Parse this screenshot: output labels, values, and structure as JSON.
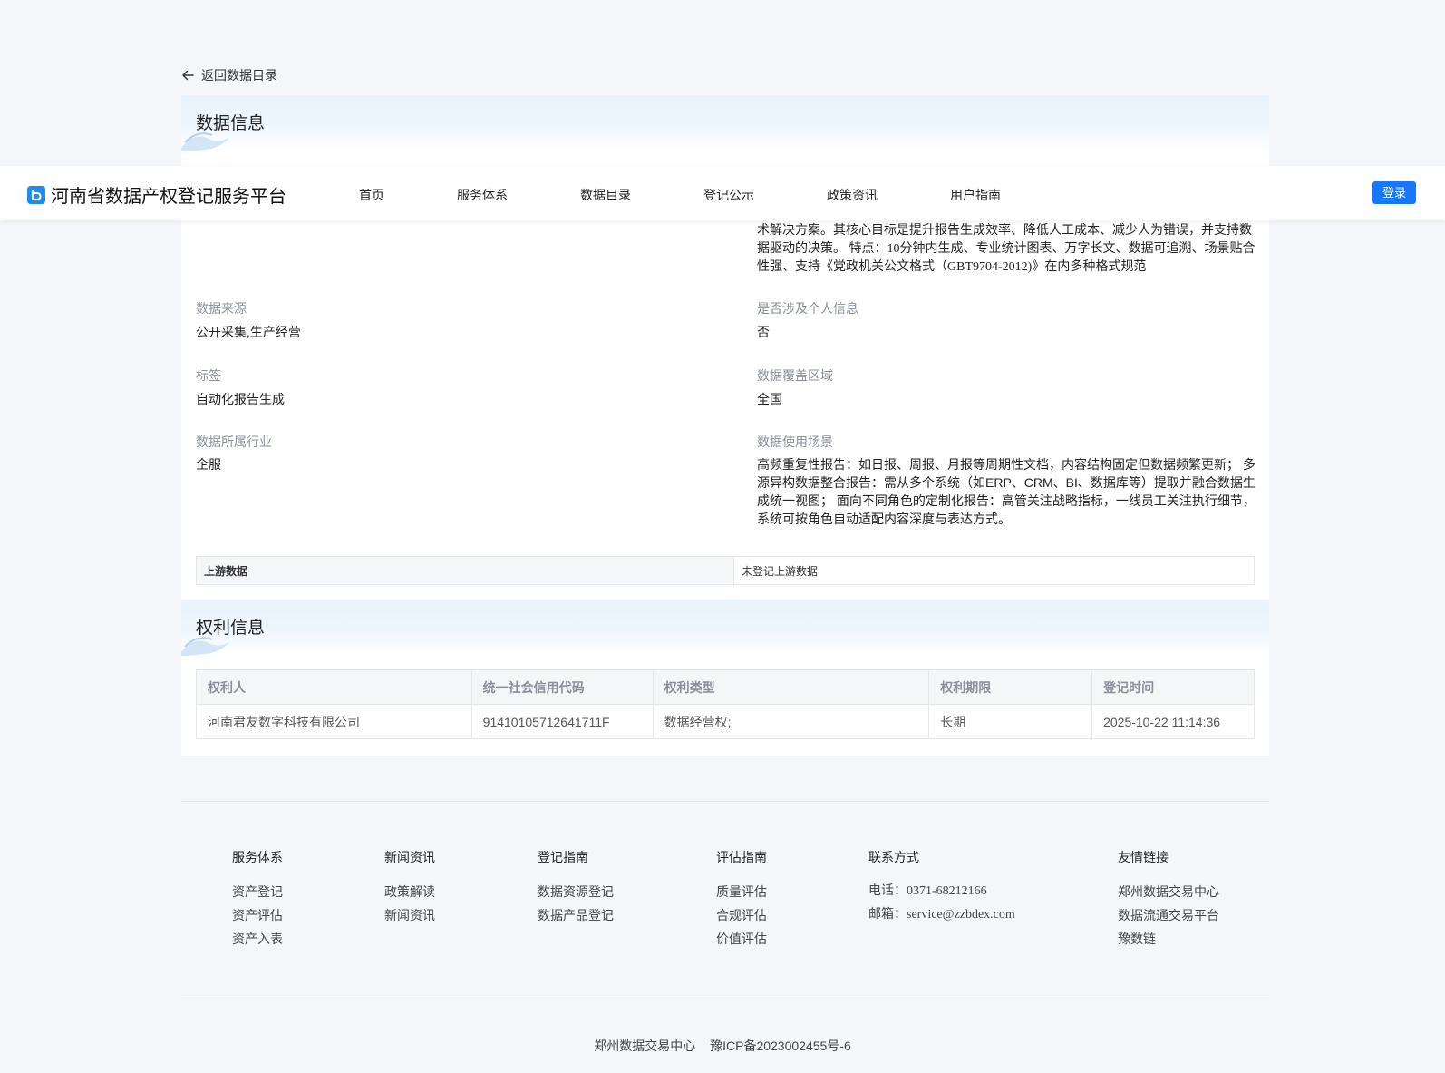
{
  "back_link": {
    "label": "返回数据目录"
  },
  "navbar": {
    "site_title": "河南省数据产权登记服务平台",
    "items": [
      "首页",
      "服务体系",
      "数据目录",
      "登记公示",
      "政策资讯",
      "用户指南"
    ],
    "login_label": "登录"
  },
  "data_info": {
    "title": "数据信息",
    "description_tail": "术解决方案。其核心目标是提升报告生成效率、降低人工成本、减少人为错误，并支持数据驱动的决策。 特点：10分钟内生成、专业统计图表、万字长文、数据可追溯、场景贴合性强、支持《党政机关公文格式（GBT9704-2012)》在内多种格式规范",
    "source_label": "数据来源",
    "source_value": "公开采集,生产经营",
    "personal_info_label": "是否涉及个人信息",
    "personal_info_value": "否",
    "tags_label": "标签",
    "tags_value": "自动化报告生成",
    "coverage_label": "数据覆盖区域",
    "coverage_value": "全国",
    "industry_label": "数据所属行业",
    "industry_value": "企服",
    "scenario_label": "数据使用场景",
    "scenario_value": "高频重复性报告：如日报、周报、月报等周期性文档，内容结构固定但数据频繁更新； 多源异构数据整合报告：需从多个系统（如ERP、CRM、BI、数据库等）提取并融合数据生成统一视图； 面向不同角色的定制化报告：高管关注战略指标，一线员工关注执行细节，系统可按角色自动适配内容深度与表达方式。",
    "upstream_label": "上游数据",
    "upstream_value": "未登记上游数据"
  },
  "rights_info": {
    "title": "权利信息",
    "columns": [
      "权利人",
      "统一社会信用代码",
      "权利类型",
      "权利期限",
      "登记时间"
    ],
    "rows": [
      [
        "河南君友数字科技有限公司",
        "91410105712641711F",
        "数据经营权;",
        "长期",
        "2025-10-22 11:14:36"
      ]
    ]
  },
  "footer": {
    "columns": [
      {
        "heading": "服务体系",
        "links": [
          "资产登记",
          "资产评估",
          "资产入表"
        ]
      },
      {
        "heading": "新闻资讯",
        "links": [
          "政策解读",
          "新闻资讯"
        ]
      },
      {
        "heading": "登记指南",
        "links": [
          "数据资源登记",
          "数据产品登记"
        ]
      },
      {
        "heading": "评估指南",
        "links": [
          "质量评估",
          "合规评估",
          "价值评估"
        ]
      },
      {
        "heading": "联系方式",
        "links": [
          "电话：0371-68212166",
          "邮箱：service@zzbdex.com"
        ]
      },
      {
        "heading": "友情链接",
        "links": [
          "郑州数据交易中心",
          "数据流通交易平台",
          "豫数链"
        ]
      }
    ],
    "org": "郑州数据交易中心",
    "icp": "豫ICP备2023002455号-6"
  },
  "colors": {
    "primary": "#1677ff",
    "logo": "#1c8cf0",
    "page_bg": "#f4f6fa"
  },
  "icons": [
    "arrow-left-icon",
    "logo-icon"
  ]
}
